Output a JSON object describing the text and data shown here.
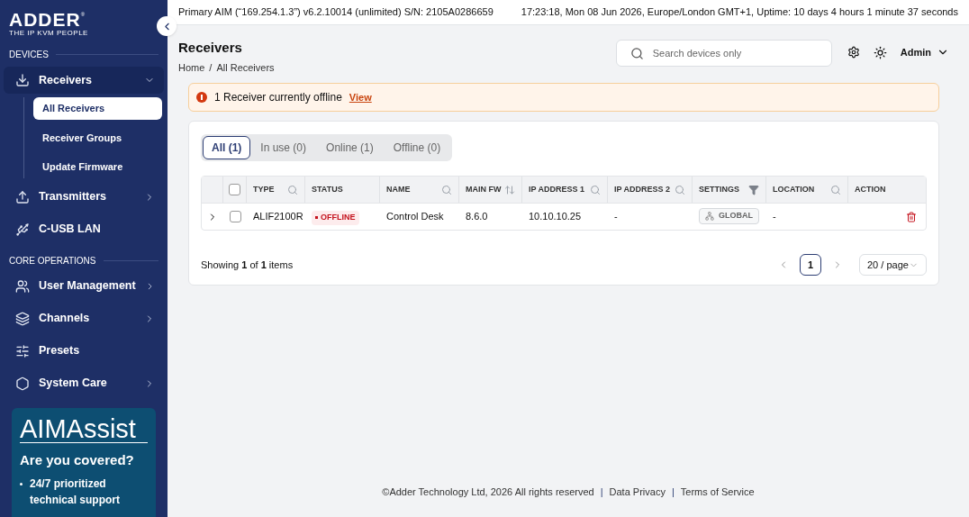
{
  "logo": {
    "brand": "ADDER",
    "mark": "®",
    "tagline": "THE IP KVM PEOPLE"
  },
  "sidebar": {
    "sections": [
      {
        "title": "DEVICES",
        "items": [
          {
            "label": "Receivers",
            "kind": "group",
            "expanded": true,
            "children": [
              {
                "label": "All Receivers",
                "selected": true
              },
              {
                "label": "Receiver Groups",
                "selected": false
              },
              {
                "label": "Update Firmware",
                "selected": false
              }
            ]
          },
          {
            "label": "Transmitters",
            "kind": "group",
            "expanded": false
          },
          {
            "label": "C-USB LAN",
            "kind": "link",
            "expanded": false
          }
        ]
      },
      {
        "title": "CORE OPERATIONS",
        "items": [
          {
            "label": "User Management",
            "kind": "group",
            "expanded": false
          },
          {
            "label": "Channels",
            "kind": "group",
            "expanded": false
          },
          {
            "label": "Presets",
            "kind": "link",
            "expanded": false
          },
          {
            "label": "System Care",
            "kind": "group",
            "expanded": false
          }
        ]
      }
    ],
    "promo": {
      "logo": "AIMAssist",
      "title": "Are you covered?",
      "bullets": [
        "24/7 prioritized technical support"
      ]
    }
  },
  "topbar": {
    "system": "Primary AIM (“169.254.1.3”) v6.2.10014 (unlimited) S/N: 2105A0286659",
    "status": "17:23:18, Mon 08 Jun 2026, Europe/London GMT+1, Uptime: 10 days 4 hours 1 minute 37 seconds"
  },
  "header": {
    "title": "Receivers",
    "breadcrumb": [
      "Home",
      "All Receivers"
    ],
    "breadcrumb_separator": "/",
    "search": {
      "placeholder": "Search devices only"
    },
    "user": "Admin"
  },
  "alert": {
    "text": "1 Receiver currently offline",
    "link": "View"
  },
  "tabs": [
    {
      "label": "All (1)",
      "selected": true
    },
    {
      "label": "In use (0)",
      "selected": false
    },
    {
      "label": "Online (1)",
      "selected": false
    },
    {
      "label": "Offline (0)",
      "selected": false
    }
  ],
  "table": {
    "columns": [
      {
        "label": "TYPE"
      },
      {
        "label": "STATUS"
      },
      {
        "label": "NAME"
      },
      {
        "label": "MAIN FW"
      },
      {
        "label": "IP ADDRESS 1"
      },
      {
        "label": "IP ADDRESS 2"
      },
      {
        "label": "SETTINGS"
      },
      {
        "label": "LOCATION"
      },
      {
        "label": "ACTION"
      }
    ],
    "header_checked": false,
    "rows": [
      {
        "expanded": false,
        "checked": false,
        "type": "ALIF2100R",
        "status": {
          "label": "OFFLINE",
          "kind": "offline"
        },
        "name": "Control Desk",
        "main_fw": "8.6.0",
        "ip_address_1": "10.10.10.25",
        "ip_address_2": "-",
        "settings": "GLOBAL",
        "location": "-"
      }
    ]
  },
  "pagination": {
    "summary": "Showing **1** of **1** items",
    "pages": [
      {
        "label": "1",
        "selected": true
      }
    ],
    "page_size": "20 / page"
  },
  "footer": [
    {
      "kind": "text",
      "text": "©Adder Technology Ltd, 2026 All rights reserved"
    },
    {
      "kind": "separator",
      "text": "|"
    },
    {
      "kind": "link",
      "text": "Data Privacy"
    },
    {
      "kind": "separator",
      "text": "|"
    },
    {
      "kind": "link",
      "text": "Terms of Service"
    }
  ]
}
